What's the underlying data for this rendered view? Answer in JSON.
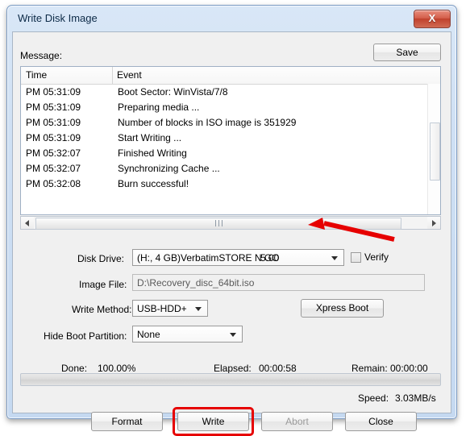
{
  "window": {
    "title": "Write Disk Image",
    "close_icon": "close-icon",
    "close_label": "X"
  },
  "message": {
    "label": "Message:",
    "save_label": "Save"
  },
  "log": {
    "columns": [
      "Time",
      "Event"
    ],
    "rows": [
      {
        "time": "PM 05:31:09",
        "event": "Boot Sector: WinVista/7/8"
      },
      {
        "time": "PM 05:31:09",
        "event": "Preparing media ..."
      },
      {
        "time": "PM 05:31:09",
        "event": "Number of blocks in ISO image is 351929"
      },
      {
        "time": "PM 05:31:09",
        "event": "Start Writing ..."
      },
      {
        "time": "PM 05:32:07",
        "event": "Finished Writing"
      },
      {
        "time": "PM 05:32:07",
        "event": "Synchronizing Cache ..."
      },
      {
        "time": "PM 05:32:08",
        "event": "Burn successful!"
      }
    ]
  },
  "form": {
    "disk_drive_label": "Disk Drive:",
    "disk_drive_value": "(H:, 4 GB)VerbatimSTORE N GO",
    "disk_drive_version": "5.00",
    "verify_label": "Verify",
    "verify_checked": false,
    "image_file_label": "Image File:",
    "image_file_value": "D:\\Recovery_disc_64bit.iso",
    "write_method_label": "Write Method:",
    "write_method_value": "USB-HDD+",
    "xpress_boot_label": "Xpress Boot",
    "hide_boot_partition_label": "Hide Boot Partition:",
    "hide_boot_partition_value": "None"
  },
  "status": {
    "done_label": "Done:",
    "done_value": "100.00%",
    "elapsed_label": "Elapsed:",
    "elapsed_value": "00:00:58",
    "remain_label": "Remain:",
    "remain_value": "00:00:00",
    "speed_label": "Speed:",
    "speed_value": "3.03MB/s",
    "progress_percent": 100
  },
  "buttons": {
    "format": "Format",
    "write": "Write",
    "abort": "Abort",
    "close": "Close"
  },
  "annotation": {
    "highlight_color": "#e60000",
    "arrow_color": "#e60000"
  }
}
